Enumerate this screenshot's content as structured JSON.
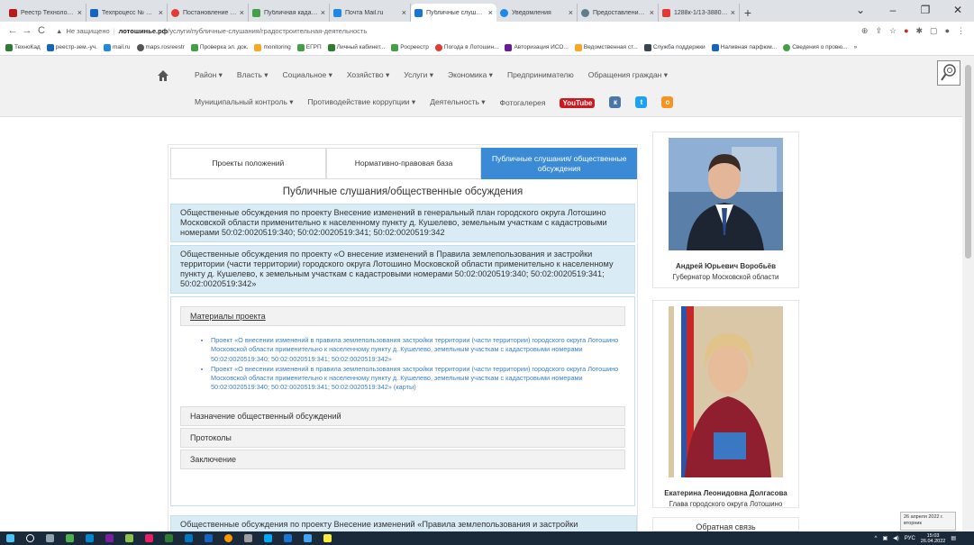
{
  "browser": {
    "tabs": [
      {
        "title": "Реестр Технологичес",
        "color": "#b71c1c"
      },
      {
        "title": "Техпроцесс № P001",
        "color": "#1565c0"
      },
      {
        "title": "Постановление Пра",
        "color": "#e53935"
      },
      {
        "title": "Публичная кадастро",
        "color": "#43a047"
      },
      {
        "title": "Почта Mail.ru",
        "color": "#1e88e5"
      },
      {
        "title": "Публичные слушани",
        "color": "#1976d2",
        "active": true
      },
      {
        "title": "Уведомления",
        "color": "#1e88e5"
      },
      {
        "title": "Предоставление све",
        "color": "#607d8b"
      },
      {
        "title": "1288к-1/13-3880 | 3",
        "color": "#e53935"
      }
    ],
    "new_tab": "+",
    "address": {
      "warning": "Не защищено",
      "domain": "лотошинье.рф",
      "path": "/услуги/публичные-слушания/градостроительная-деятельность"
    },
    "bookmarks": [
      {
        "label": "ТехноКад",
        "color": "#2e7d32"
      },
      {
        "label": "реестр-зем.-уч.",
        "color": "#1565c0"
      },
      {
        "label": "mail.ru",
        "color": "#1e88e5"
      },
      {
        "label": "maps.rosreestr",
        "color": "#555555"
      },
      {
        "label": "Проверка эл. док.",
        "color": "#43a047"
      },
      {
        "label": "monitoring",
        "color": "#f9a825"
      },
      {
        "label": "ЕГРП",
        "color": "#43a047"
      },
      {
        "label": "Личный кабинет...",
        "color": "#2e7d32"
      },
      {
        "label": "Росреестр",
        "color": "#43a047"
      },
      {
        "label": "Погода в Лотошин...",
        "color": "#e53935"
      },
      {
        "label": "Авторизация ИСО...",
        "color": "#6a1b9a"
      },
      {
        "label": "Ведомственная ст...",
        "color": "#f9a825"
      },
      {
        "label": "Служба поддержки",
        "color": "#37474f"
      },
      {
        "label": "Наливная парфюм...",
        "color": "#1565c0"
      },
      {
        "label": "Сведения о провю...",
        "color": "#43a047"
      }
    ]
  },
  "site": {
    "nav_row1": [
      "Район ▾",
      "Власть ▾",
      "Социальное ▾",
      "Хозяйство ▾",
      "Услуги ▾",
      "Экономика ▾",
      "Предпринимателю",
      "Обращения граждан ▾"
    ],
    "nav_row2": [
      "Муниципальный контроль ▾",
      "Противодействие коррупции ▾",
      "Деятельность ▾",
      "Фотогалерея"
    ],
    "youtube": "YouTube",
    "social_colors": [
      "#4a76a8",
      "#1da1f2",
      "#f7931e"
    ],
    "social_glyphs": [
      "к",
      "t",
      "о"
    ]
  },
  "content": {
    "tabs": [
      "Проекты положений",
      "Нормативно-правовая база",
      "Публичные слушания/ общественные обсуждения"
    ],
    "title": "Публичные слушания/общественные обсуждения",
    "item1": "Общественные обсуждения по проекту Внесение изменений в генеральный план городского округа Лотошино Московской области применительно к населенному пункту д. Кушелево, земельным участкам с кадастровыми номерами 50:02:0020519:340; 50:02:0020519:341; 50:02:0020519:342",
    "item2": "Общественные обсуждения по проекту «О внесение изменений в Правила землепользования и застройки территории (части территории) городского округа Лотошино Московской области применительно к населенному пункту д. Кушелево, к земельным участкам с кадастровыми номерами 50:02:0020519:340; 50:02:0020519:341; 50:02:0020519:342»",
    "materials": "Материалы проекта",
    "doc1": "Проект «О внесении изменений в правила землепользования застройки территории (части территории) городского округа Лотошино Московской области применительно к населенному пункту д. Кушелево, земельным участкам с кадастровыми номерами 50:02:0020519:340; 50:02:0020519:341; 50:02:0020519:342»",
    "doc2": "Проект «О внесении изменений в правила землепользования застройки территории (части территории) городского округа Лотошино Московской области применительно к населенному пункту д. Кушелево, земельным участкам с кадастровыми номерами 50:02:0020519:340; 50:02:0020519:341; 50:02:0020519:342» (карты)",
    "sub1": "Назначение общественный обсуждений",
    "sub2": "Протоколы",
    "sub3": "Заключение",
    "item3": "Общественные обсуждения по проекту Внесение изменений «Правила землепользования и застройки"
  },
  "sidebar": {
    "person1": {
      "name": "Андрей Юрьевич Воробьёв",
      "position": "Губернатор Московской области"
    },
    "person2": {
      "name": "Екатерина Леонидовна Долгасова",
      "position": "Глава городского округа Лотошино"
    },
    "more": "Обратная связь"
  },
  "taskbar": {
    "lang": "РУС",
    "time": "15:03",
    "date": "26.04.2022",
    "notify_date": "26 апреля 2022 г.",
    "notify_day": "вторник"
  }
}
